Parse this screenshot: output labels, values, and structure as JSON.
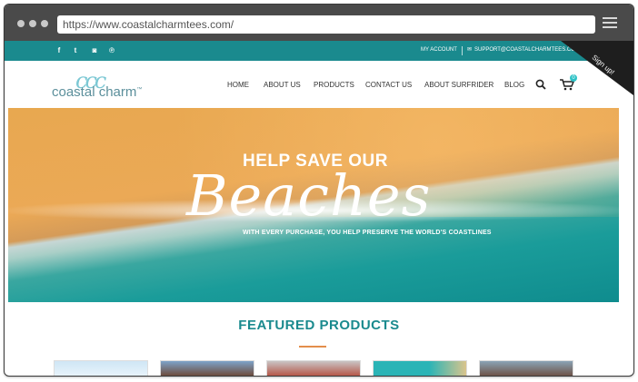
{
  "browser": {
    "url": "https://www.coastalcharmtees.com/"
  },
  "topbar": {
    "social_icons": [
      "facebook-icon",
      "twitter-icon",
      "instagram-icon",
      "pinterest-icon"
    ],
    "social_glyphs": [
      "f",
      "t",
      "◙",
      "℗"
    ],
    "my_account": "MY ACCOUNT",
    "support_email": "SUPPORT@COASTALCHARMTEES.COM",
    "signup": "Sign up!"
  },
  "header": {
    "logo_mark": "ccc",
    "logo_text": "coastal charm",
    "logo_tm": "™",
    "nav": [
      "HOME",
      "ABOUT US",
      "PRODUCTS",
      "CONTACT US",
      "ABOUT SURFRIDER",
      "BLOG"
    ],
    "cart_count": "0"
  },
  "hero": {
    "line1": "HELP SAVE OUR",
    "line2": "Beaches",
    "line3": "WITH EVERY PURCHASE, YOU HELP PRESERVE THE WORLD'S COASTLINES"
  },
  "featured": {
    "title": "FEATURED PRODUCTS"
  },
  "colors": {
    "teal": "#1a8a8e",
    "accent_orange": "#e38e4b",
    "chrome": "#4a4a4a"
  }
}
